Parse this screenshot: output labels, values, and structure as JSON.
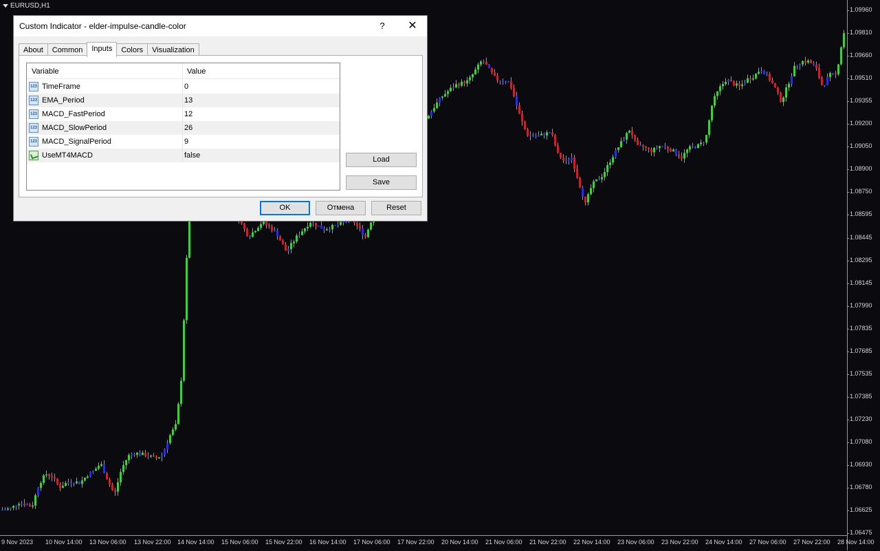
{
  "chart": {
    "symbol": "EURUSD,H1",
    "colors": {
      "bull": "#2bdc2b",
      "bear": "#e8141e",
      "neutral": "#2828ff",
      "background": "#0a0a0f"
    },
    "price_ticks": [
      "1.09960",
      "1.09810",
      "1.09660",
      "1.09510",
      "1.09355",
      "1.09200",
      "1.09050",
      "1.08900",
      "1.08750",
      "1.08595",
      "1.08445",
      "1.08295",
      "1.08145",
      "1.07990",
      "1.07835",
      "1.07685",
      "1.07535",
      "1.07385",
      "1.07230",
      "1.07080",
      "1.06930",
      "1.06780",
      "1.06625",
      "1.06475"
    ],
    "time_ticks": [
      "9 Nov 2023",
      "10 Nov 14:00",
      "13 Nov 06:00",
      "13 Nov 22:00",
      "14 Nov 14:00",
      "15 Nov 06:00",
      "15 Nov 22:00",
      "16 Nov 14:00",
      "17 Nov 06:00",
      "17 Nov 22:00",
      "20 Nov 14:00",
      "21 Nov 06:00",
      "21 Nov 22:00",
      "22 Nov 14:00",
      "23 Nov 06:00",
      "23 Nov 22:00",
      "24 Nov 14:00",
      "27 Nov 06:00",
      "27 Nov 22:00",
      "28 Nov 14:00"
    ]
  },
  "chart_data": {
    "type": "candlestick",
    "symbol": "EURUSD",
    "timeframe": "H1",
    "ylim": [
      1.06475,
      1.0996
    ],
    "x_range": [
      "9 Nov 2023",
      "28 Nov 14:00"
    ],
    "close_path": [
      [
        0,
        1.0663
      ],
      [
        15,
        1.0664
      ],
      [
        25,
        1.0668
      ],
      [
        35,
        1.0667
      ],
      [
        45,
        1.0665
      ],
      [
        55,
        1.068
      ],
      [
        65,
        1.0687
      ],
      [
        75,
        1.0685
      ],
      [
        85,
        1.0678
      ],
      [
        95,
        1.0681
      ],
      [
        105,
        1.0682
      ],
      [
        115,
        1.0681
      ],
      [
        125,
        1.0686
      ],
      [
        135,
        1.0689
      ],
      [
        145,
        1.0694
      ],
      [
        155,
        1.0683
      ],
      [
        165,
        1.0673
      ],
      [
        175,
        1.069
      ],
      [
        185,
        1.0699
      ],
      [
        195,
        1.0701
      ],
      [
        205,
        1.07
      ],
      [
        215,
        1.0699
      ],
      [
        225,
        1.0697
      ],
      [
        235,
        1.07
      ],
      [
        245,
        1.0712
      ],
      [
        255,
        1.072
      ],
      [
        262,
        1.075
      ],
      [
        266,
        1.079
      ],
      [
        270,
        1.083
      ],
      [
        274,
        1.086
      ],
      [
        280,
        1.0885
      ],
      [
        300,
        1.089
      ],
      [
        320,
        1.0895
      ],
      [
        340,
        1.0862
      ],
      [
        360,
        1.0845
      ],
      [
        380,
        1.0855
      ],
      [
        400,
        1.0848
      ],
      [
        415,
        1.0835
      ],
      [
        430,
        1.0845
      ],
      [
        450,
        1.0855
      ],
      [
        470,
        1.085
      ],
      [
        490,
        1.0853
      ],
      [
        510,
        1.0857
      ],
      [
        530,
        1.0845
      ],
      [
        540,
        1.0858
      ],
      [
        560,
        1.088
      ],
      [
        580,
        1.09
      ],
      [
        600,
        1.0912
      ],
      [
        620,
        1.0925
      ],
      [
        640,
        1.0938
      ],
      [
        660,
        1.0946
      ],
      [
        680,
        1.0949
      ],
      [
        700,
        1.0963
      ],
      [
        720,
        1.095
      ],
      [
        740,
        1.0948
      ],
      [
        755,
        1.0925
      ],
      [
        765,
        1.0913
      ],
      [
        780,
        1.0912
      ],
      [
        800,
        1.0915
      ],
      [
        810,
        1.09
      ],
      [
        820,
        1.0895
      ],
      [
        830,
        1.0898
      ],
      [
        840,
        1.0882
      ],
      [
        850,
        1.0867
      ],
      [
        860,
        1.088
      ],
      [
        875,
        1.0886
      ],
      [
        890,
        1.0899
      ],
      [
        905,
        1.091
      ],
      [
        915,
        1.0917
      ],
      [
        925,
        1.0905
      ],
      [
        935,
        1.0905
      ],
      [
        945,
        1.0902
      ],
      [
        960,
        1.0906
      ],
      [
        975,
        1.0903
      ],
      [
        990,
        1.0898
      ],
      [
        1000,
        1.0904
      ],
      [
        1015,
        1.0906
      ],
      [
        1025,
        1.091
      ],
      [
        1035,
        1.0935
      ],
      [
        1045,
        1.0944
      ],
      [
        1055,
        1.095
      ],
      [
        1065,
        1.0947
      ],
      [
        1075,
        1.0945
      ],
      [
        1085,
        1.095
      ],
      [
        1095,
        1.0952
      ],
      [
        1105,
        1.0957
      ],
      [
        1115,
        1.0952
      ],
      [
        1125,
        1.0945
      ],
      [
        1135,
        1.0935
      ],
      [
        1145,
        1.0947
      ],
      [
        1155,
        1.0959
      ],
      [
        1165,
        1.0962
      ],
      [
        1175,
        1.0962
      ],
      [
        1185,
        1.0958
      ],
      [
        1195,
        1.0945
      ],
      [
        1205,
        1.0953
      ],
      [
        1215,
        1.0953
      ],
      [
        1225,
        1.098
      ],
      [
        1230,
        1.0985
      ]
    ]
  },
  "dialog": {
    "title": "Custom Indicator - elder-impulse-candle-color",
    "help": "?",
    "close": "✕",
    "tabs": [
      "About",
      "Common",
      "Inputs",
      "Colors",
      "Visualization"
    ],
    "active_tab": "Inputs",
    "columns": {
      "variable": "Variable",
      "value": "Value"
    },
    "params": [
      {
        "name": "TimeFrame",
        "value": "0",
        "icon": "123"
      },
      {
        "name": "EMA_Period",
        "value": "13",
        "icon": "123"
      },
      {
        "name": "MACD_FastPeriod",
        "value": "12",
        "icon": "123"
      },
      {
        "name": "MACD_SlowPeriod",
        "value": "26",
        "icon": "123"
      },
      {
        "name": "MACD_SignalPeriod",
        "value": "9",
        "icon": "123"
      },
      {
        "name": "UseMT4MACD",
        "value": "false",
        "icon": "bool"
      }
    ],
    "buttons": {
      "load": "Load",
      "save": "Save",
      "ok": "OK",
      "cancel": "Отмена",
      "reset": "Reset"
    }
  }
}
